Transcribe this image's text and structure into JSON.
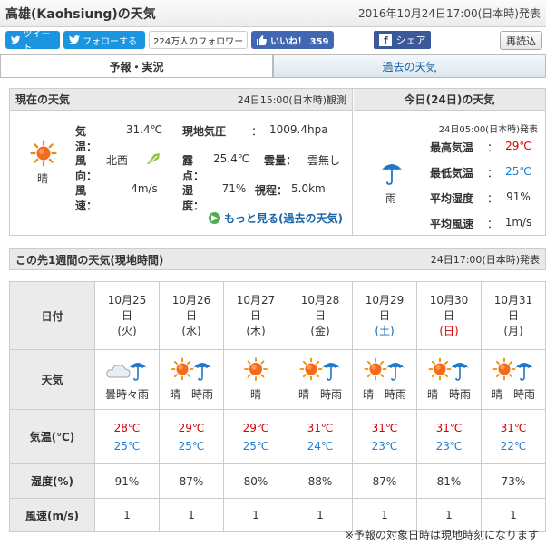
{
  "header": {
    "title": "高雄(Kaohsiung)の天気",
    "issued": "2016年10月24日17:00(日本時)発表"
  },
  "social": {
    "tweet": "ツイート",
    "follow": "フォローする",
    "followers": "224万人のフォロワー",
    "like": "いいね！ 359",
    "share": "シェア",
    "reload": "再読込"
  },
  "tabs": {
    "forecast": "予報・実況",
    "past": "過去の天気"
  },
  "current": {
    "heading": "現在の天気",
    "observed": "24日15:00(日本時)観測",
    "condition": "晴",
    "icon": "sun-icon",
    "temp_label": "気温：",
    "temp": "31.4℃",
    "pressure_label": "現地気圧",
    "pressure_sep": "：",
    "pressure": "1009.4hpa",
    "wind_dir_label": "風向：",
    "wind_dir": "北西",
    "dew_label": "露点：",
    "dew": "25.4℃",
    "cloud_label": "雲量：",
    "cloud": "雲無し",
    "wind_speed_label": "風速：",
    "wind_speed": "4m/s",
    "humidity_label": "湿度：",
    "humidity": "71%",
    "visibility_label": "視程：",
    "visibility": "5.0km",
    "more": "もっと見る(過去の天気)"
  },
  "today": {
    "heading": "今日(24日)の天気",
    "issued": "24日05:00(日本時)発表",
    "condition": "雨",
    "icon": "umbrella-icon",
    "rows": [
      {
        "label": "最高気温",
        "sep": "：",
        "value": "29℃",
        "color": "#d60000"
      },
      {
        "label": "最低気温",
        "sep": "：",
        "value": "25℃",
        "color": "#1a7dd6"
      },
      {
        "label": "平均湿度",
        "sep": "：",
        "value": "91%",
        "color": "#333333"
      },
      {
        "label": "平均風速",
        "sep": "：",
        "value": "1m/s",
        "color": "#333333"
      }
    ]
  },
  "week": {
    "heading": "この先1週間の天気(現地時間)",
    "issued": "24日17:00(日本時)発表",
    "row_labels": {
      "date": "日付",
      "weather": "天気",
      "temp": "気温(℃)",
      "humidity": "湿度(%)",
      "wind": "風速(m/s)"
    },
    "days": [
      {
        "md": "10月25",
        "d": "日",
        "wd": "(火)",
        "wd_color": "#333333",
        "icon": "cloud-umbrella-icon",
        "wx": "曇時々雨",
        "hi": "28℃",
        "lo": "25℃",
        "hum": "91%",
        "wind": "1"
      },
      {
        "md": "10月26",
        "d": "日",
        "wd": "(水)",
        "wd_color": "#333333",
        "icon": "sun-umbrella-icon",
        "wx": "晴一時雨",
        "hi": "29℃",
        "lo": "25℃",
        "hum": "87%",
        "wind": "1"
      },
      {
        "md": "10月27",
        "d": "日",
        "wd": "(木)",
        "wd_color": "#333333",
        "icon": "sun-icon",
        "wx": "晴",
        "hi": "29℃",
        "lo": "25℃",
        "hum": "80%",
        "wind": "1"
      },
      {
        "md": "10月28",
        "d": "日",
        "wd": "(金)",
        "wd_color": "#333333",
        "icon": "sun-umbrella-icon",
        "wx": "晴一時雨",
        "hi": "31℃",
        "lo": "24℃",
        "hum": "88%",
        "wind": "1"
      },
      {
        "md": "10月29",
        "d": "日",
        "wd": "(土)",
        "wd_color": "#1a64a8",
        "icon": "sun-umbrella-icon",
        "wx": "晴一時雨",
        "hi": "31℃",
        "lo": "23℃",
        "hum": "87%",
        "wind": "1"
      },
      {
        "md": "10月30",
        "d": "日",
        "wd": "(日)",
        "wd_color": "#d60000",
        "icon": "sun-umbrella-icon",
        "wx": "晴一時雨",
        "hi": "31℃",
        "lo": "23℃",
        "hum": "81%",
        "wind": "1"
      },
      {
        "md": "10月31",
        "d": "日",
        "wd": "(月)",
        "wd_color": "#333333",
        "icon": "sun-umbrella-icon",
        "wx": "晴一時雨",
        "hi": "31℃",
        "lo": "22℃",
        "hum": "73%",
        "wind": "1"
      }
    ]
  },
  "footnote": "※予報の対象日時は現地時刻になります"
}
